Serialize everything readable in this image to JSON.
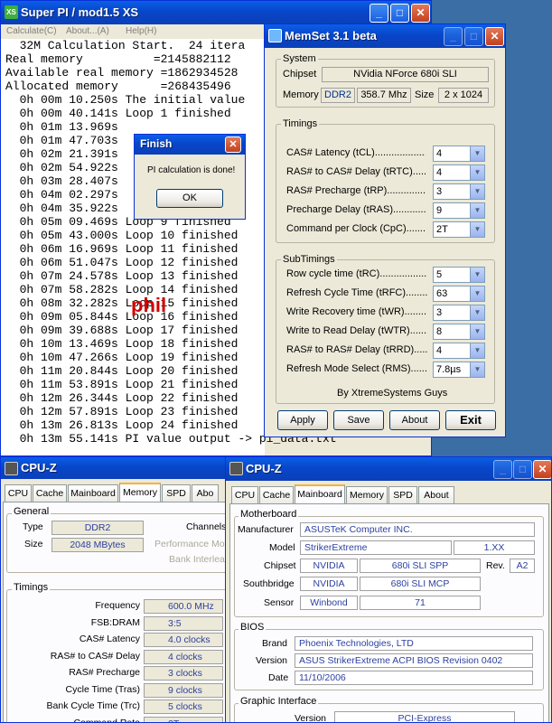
{
  "superpi": {
    "logo": "XS",
    "title": "Super PI / mod1.5 XS",
    "menu": [
      "Calculate(C)",
      "About...(A)",
      "Help(H)"
    ],
    "lines": [
      "  32M Calculation Start.  24 itera",
      "Real memory          =2145882112",
      "Available real memory =1862934528",
      "Allocated memory      =268435496",
      "  0h 00m 10.250s The initial value",
      "  0h 00m 40.141s Loop 1 finished",
      "  0h 01m 13.969s",
      "  0h 01m 47.703s",
      "  0h 02m 21.391s",
      "  0h 02m 54.922s",
      "  0h 03m 28.407s",
      "  0h 04m 02.297s",
      "  0h 04m 35.922s",
      "  0h 05m 09.469s Loop 9 finished",
      "  0h 05m 43.000s Loop 10 finished",
      "  0h 06m 16.969s Loop 11 finished",
      "  0h 06m 51.047s Loop 12 finished",
      "  0h 07m 24.578s Loop 13 finished",
      "  0h 07m 58.282s Loop 14 finished",
      "  0h 08m 32.282s Loop 15 finished",
      "  0h 09m 05.844s Loop 16 finished",
      "  0h 09m 39.688s Loop 17 finished",
      "  0h 10m 13.469s Loop 18 finished",
      "  0h 10m 47.266s Loop 19 finished",
      "  0h 11m 20.844s Loop 20 finished",
      "  0h 11m 53.891s Loop 21 finished",
      "  0h 12m 26.344s Loop 22 finished",
      "  0h 12m 57.891s Loop 23 finished",
      "  0h 13m 26.813s Loop 24 finished",
      "  0h 13m 55.141s PI value output -> pi_data.txt"
    ],
    "watermark": "phil"
  },
  "finish": {
    "title": "Finish",
    "message": "PI calculation is done!",
    "ok": "OK"
  },
  "memset": {
    "title": "MemSet 3.1 beta",
    "system_label": "System",
    "chipset_label": "Chipset",
    "chipset": "NVidia NForce 680i SLI",
    "memory_label": "Memory",
    "mem_type": "DDR2",
    "mem_freq": "358.7 Mhz",
    "size_label": "Size",
    "mem_size": "2 x 1024",
    "timings_label": "Timings",
    "timings": [
      {
        "label": "CAS# Latency (tCL)....................",
        "value": "4"
      },
      {
        "label": "RAS# to CAS# Delay (tRTC)..........",
        "value": "4"
      },
      {
        "label": "RAS# Precharge (tRP)...................",
        "value": "3"
      },
      {
        "label": "Precharge Delay  (tRAS).................",
        "value": "9"
      },
      {
        "label": "Command per Clock (CpC)..........",
        "value": "2T"
      }
    ],
    "subtimings_label": "SubTimings",
    "subtimings": [
      {
        "label": "Row cycle time (tRC)......................",
        "value": "5"
      },
      {
        "label": "Refresh Cycle Time (tRFC)...........",
        "value": "63"
      },
      {
        "label": "Write Recovery time (tWR).............",
        "value": "3"
      },
      {
        "label": "Write to Read Delay (tWTR)..........",
        "value": "8"
      },
      {
        "label": "RAS# to RAS# Delay (tRRD).......",
        "value": "4"
      },
      {
        "label": "Refresh Mode Select (RMS).........",
        "value": "7.8µs"
      }
    ],
    "credit": "By XtremeSystems Guys",
    "apply": "Apply",
    "save": "Save",
    "about": "About",
    "exit": "Exit"
  },
  "cpuz_memory": {
    "title": "CPU-Z",
    "tabs": [
      "CPU",
      "Cache",
      "Mainboard",
      "Memory",
      "SPD",
      "Abo"
    ],
    "general_label": "General",
    "type_label": "Type",
    "type": "DDR2",
    "size_label": "Size",
    "size": "2048 MBytes",
    "channels_label": "Channels",
    "perf_label": "Performance Mo",
    "bank_label": "Bank Interleav",
    "timings_label": "Timings",
    "rows": [
      {
        "label": "Frequency",
        "value": "600.0 MHz"
      },
      {
        "label": "FSB:DRAM",
        "value": "3:5"
      },
      {
        "label": "CAS# Latency",
        "value": "4.0 clocks"
      },
      {
        "label": "RAS# to CAS# Delay",
        "value": "4 clocks"
      },
      {
        "label": "RAS# Precharge",
        "value": "3 clocks"
      },
      {
        "label": "Cycle Time (Tras)",
        "value": "9 clocks"
      },
      {
        "label": "Bank Cycle Time (Trc)",
        "value": "5 clocks"
      },
      {
        "label": "Command Rate",
        "value": "2T"
      }
    ]
  },
  "cpuz_mainboard": {
    "title": "CPU-Z",
    "tabs": [
      "CPU",
      "Cache",
      "Mainboard",
      "Memory",
      "SPD",
      "About"
    ],
    "motherboard_label": "Motherboard",
    "manufacturer_label": "Manufacturer",
    "manufacturer": "ASUSTeK Computer INC.",
    "model_label": "Model",
    "model": "StrikerExtreme",
    "model_rev": "1.XX",
    "chipset_label": "Chipset",
    "chipset_vendor": "NVIDIA",
    "chipset_name": "680i SLI SPP",
    "rev_label": "Rev.",
    "rev": "A2",
    "southbridge_label": "Southbridge",
    "sb_vendor": "NVIDIA",
    "sb_name": "680i SLI MCP",
    "sensor_label": "Sensor",
    "sensor_vendor": "Winbond",
    "sensor_id": "71",
    "bios_label": "BIOS",
    "brand_label": "Brand",
    "brand": "Phoenix Technologies, LTD",
    "version_label": "Version",
    "bios_version": "ASUS StrikerExtreme ACPI BIOS Revision 0402",
    "date_label": "Date",
    "date": "11/10/2006",
    "graphic_label": "Graphic Interface",
    "gversion_label": "Version",
    "gversion": "PCI-Express"
  },
  "colors": {
    "titlebar": "#0a4fd6",
    "window": "#ece9d8",
    "value_blue": "#2b3fa1",
    "watermark": "#d10000"
  }
}
